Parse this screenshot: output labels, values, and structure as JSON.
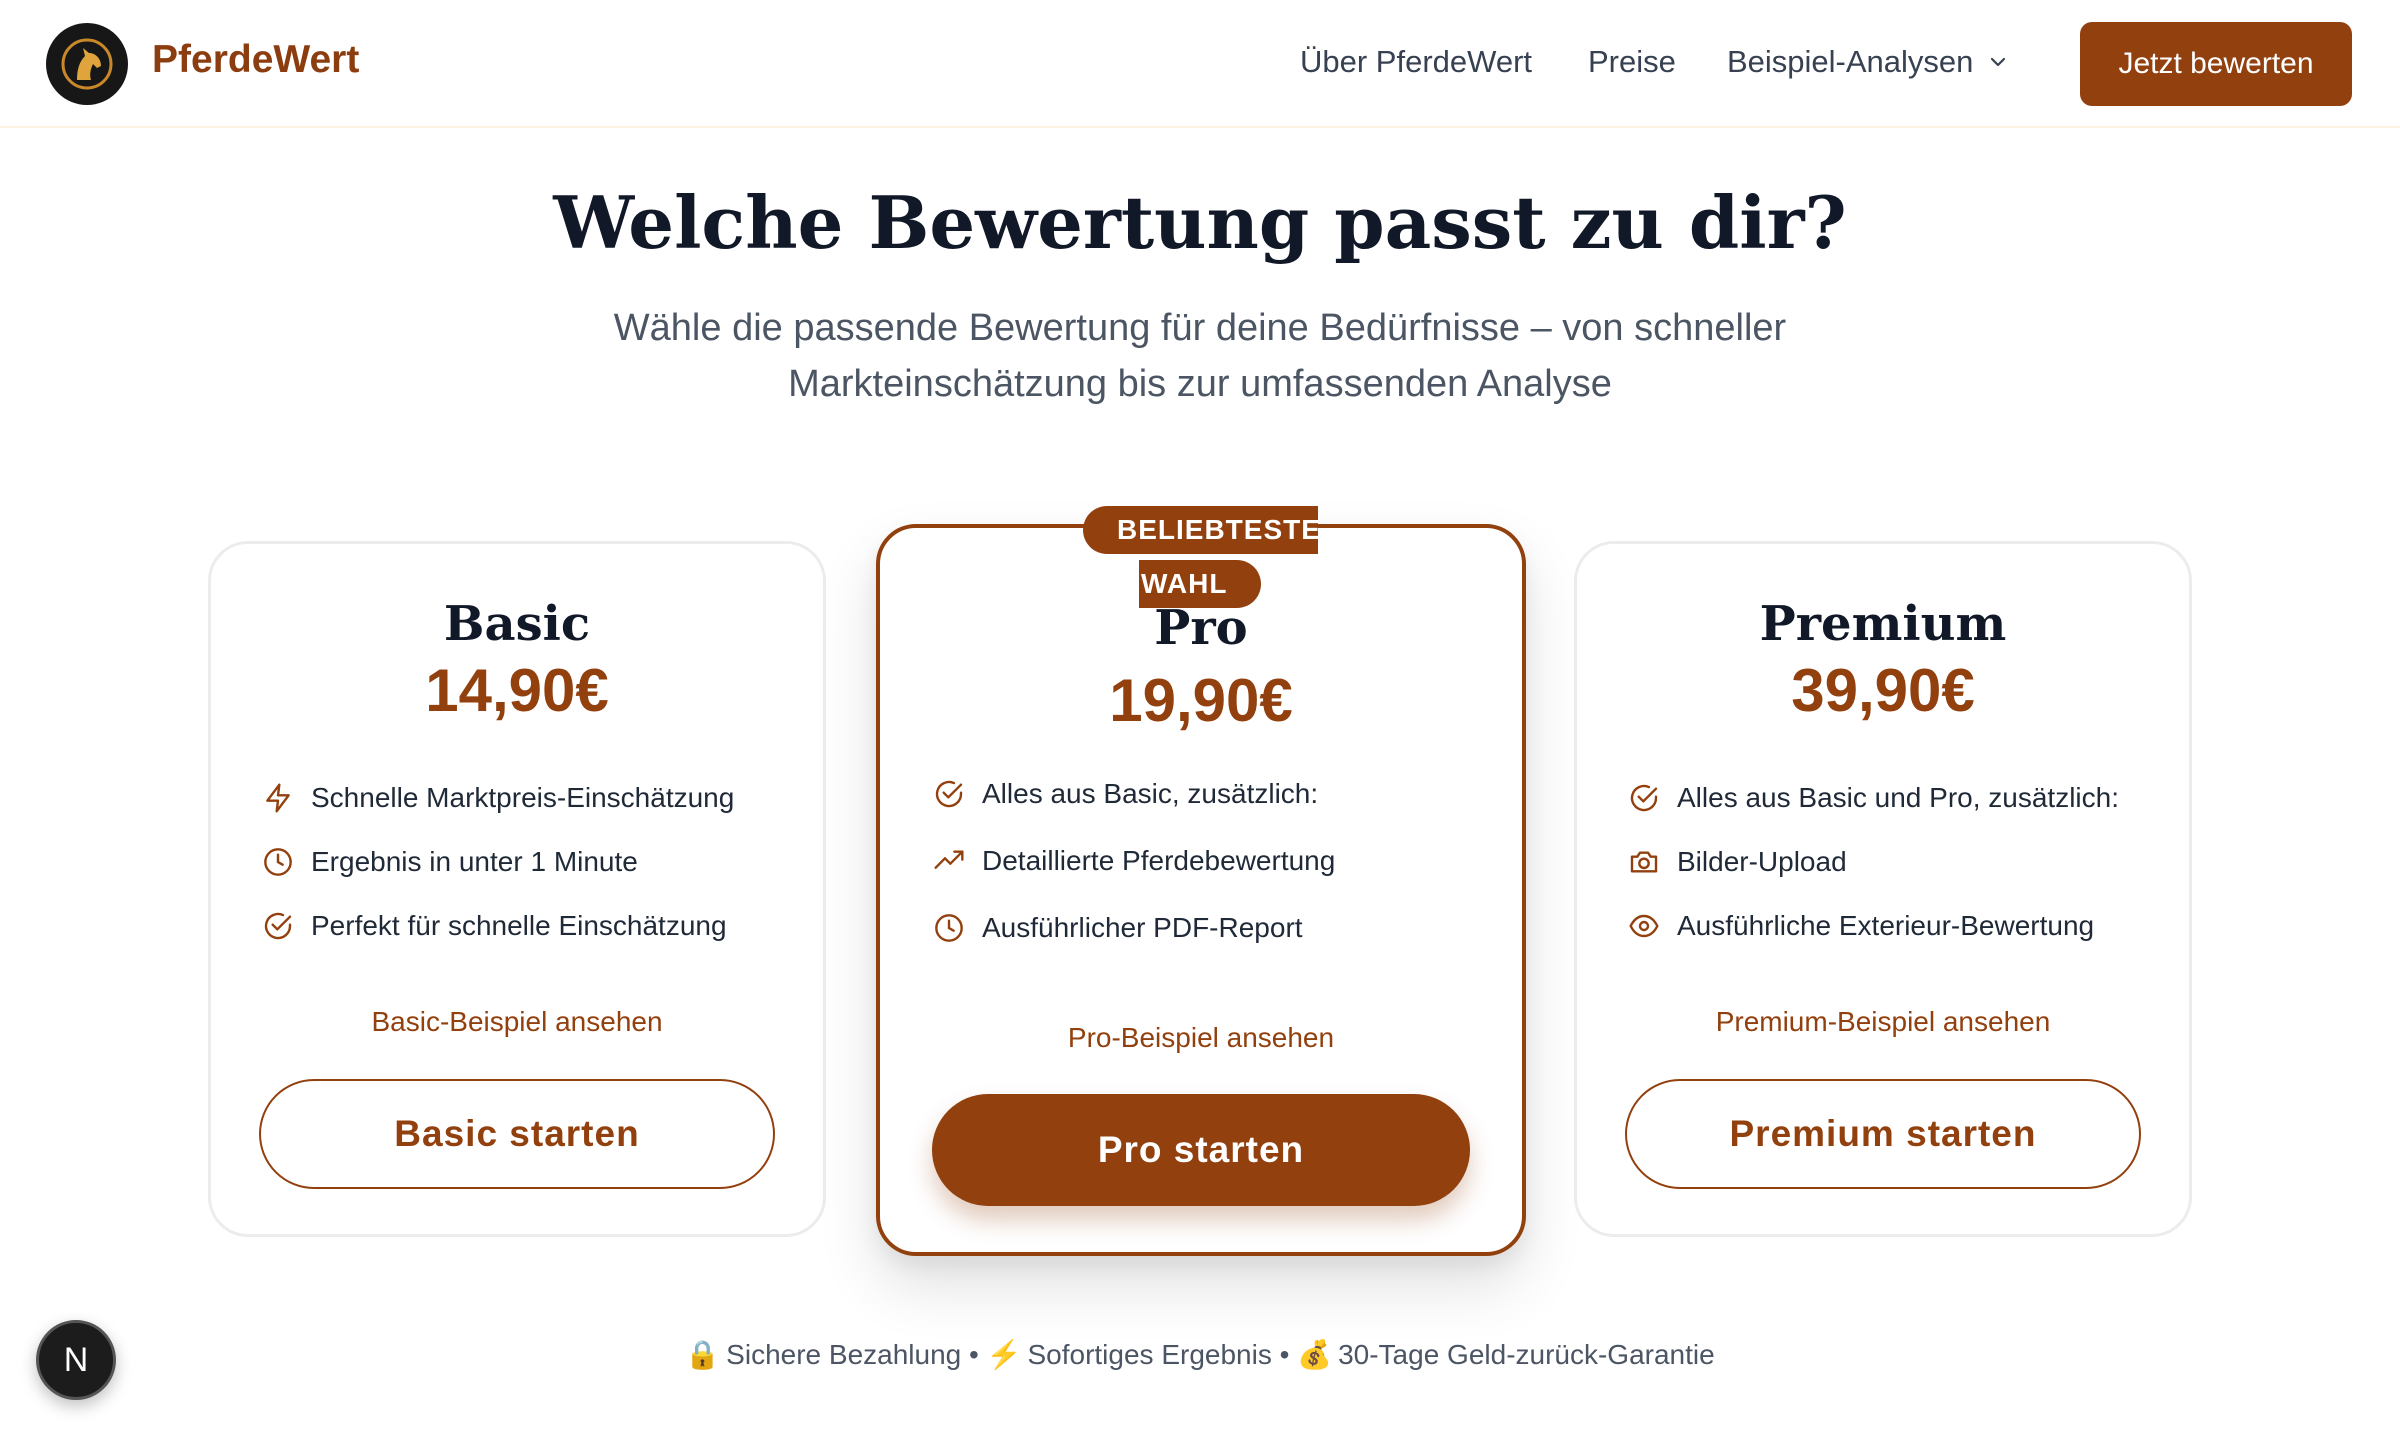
{
  "header": {
    "brand": "PferdeWert",
    "nav": {
      "about": "Über PferdeWert",
      "prices": "Preise",
      "examples": "Beispiel-Analysen"
    },
    "cta_label": "Jetzt bewerten",
    "logo_icon": "horse-head-icon",
    "dropdown_icon": "chevron-down-icon"
  },
  "hero": {
    "title": "Welche Bewertung passt zu dir?",
    "subtitle_line1": "Wähle die passende Bewertung für deine Bedürfnisse – von schneller",
    "subtitle_line2": "Markteinschätzung bis zur umfassenden Analyse"
  },
  "plans": {
    "basic": {
      "name": "Basic",
      "price": "14,90€",
      "features": [
        {
          "icon": "lightning-icon",
          "text": "Schnelle Marktpreis-Einschätzung"
        },
        {
          "icon": "clock-icon",
          "text": "Ergebnis in unter 1 Minute"
        },
        {
          "icon": "check-circle-icon",
          "text": "Perfekt für schnelle Einschätzung"
        }
      ],
      "example_link": "Basic-Beispiel ansehen",
      "button": "Basic starten"
    },
    "pro": {
      "badge_line1": "BELIEBTESTE",
      "badge_line2": "WAHL",
      "name": "Pro",
      "price": "19,90€",
      "features": [
        {
          "icon": "check-circle-icon",
          "text": "Alles aus Basic, zusätzlich:"
        },
        {
          "icon": "trending-up-icon",
          "text": "Detaillierte Pferdebewertung"
        },
        {
          "icon": "clock-icon",
          "text": "Ausführlicher PDF-Report"
        }
      ],
      "example_link": "Pro-Beispiel ansehen",
      "button": "Pro starten"
    },
    "premium": {
      "name": "Premium",
      "price": "39,90€",
      "features": [
        {
          "icon": "check-circle-icon",
          "text": "Alles aus Basic und Pro, zusätzlich:"
        },
        {
          "icon": "camera-icon",
          "text": "Bilder-Upload"
        },
        {
          "icon": "eye-icon",
          "text": "Ausführliche Exterieur-Bewertung"
        }
      ],
      "example_link": "Premium-Beispiel ansehen",
      "button": "Premium starten"
    }
  },
  "trust": {
    "item1_emoji": "🔒",
    "item1": "Sichere Bezahlung",
    "sep": "•",
    "item2_emoji": "⚡",
    "item2": "Sofortiges Ergebnis",
    "item3_emoji": "💰",
    "item3": "30-Tage Geld-zurück-Garantie"
  },
  "dev_badge": "N",
  "colors": {
    "accent": "#92400e",
    "brand_text": "#8b3d10",
    "heading": "#111827",
    "muted": "#4b5563"
  }
}
